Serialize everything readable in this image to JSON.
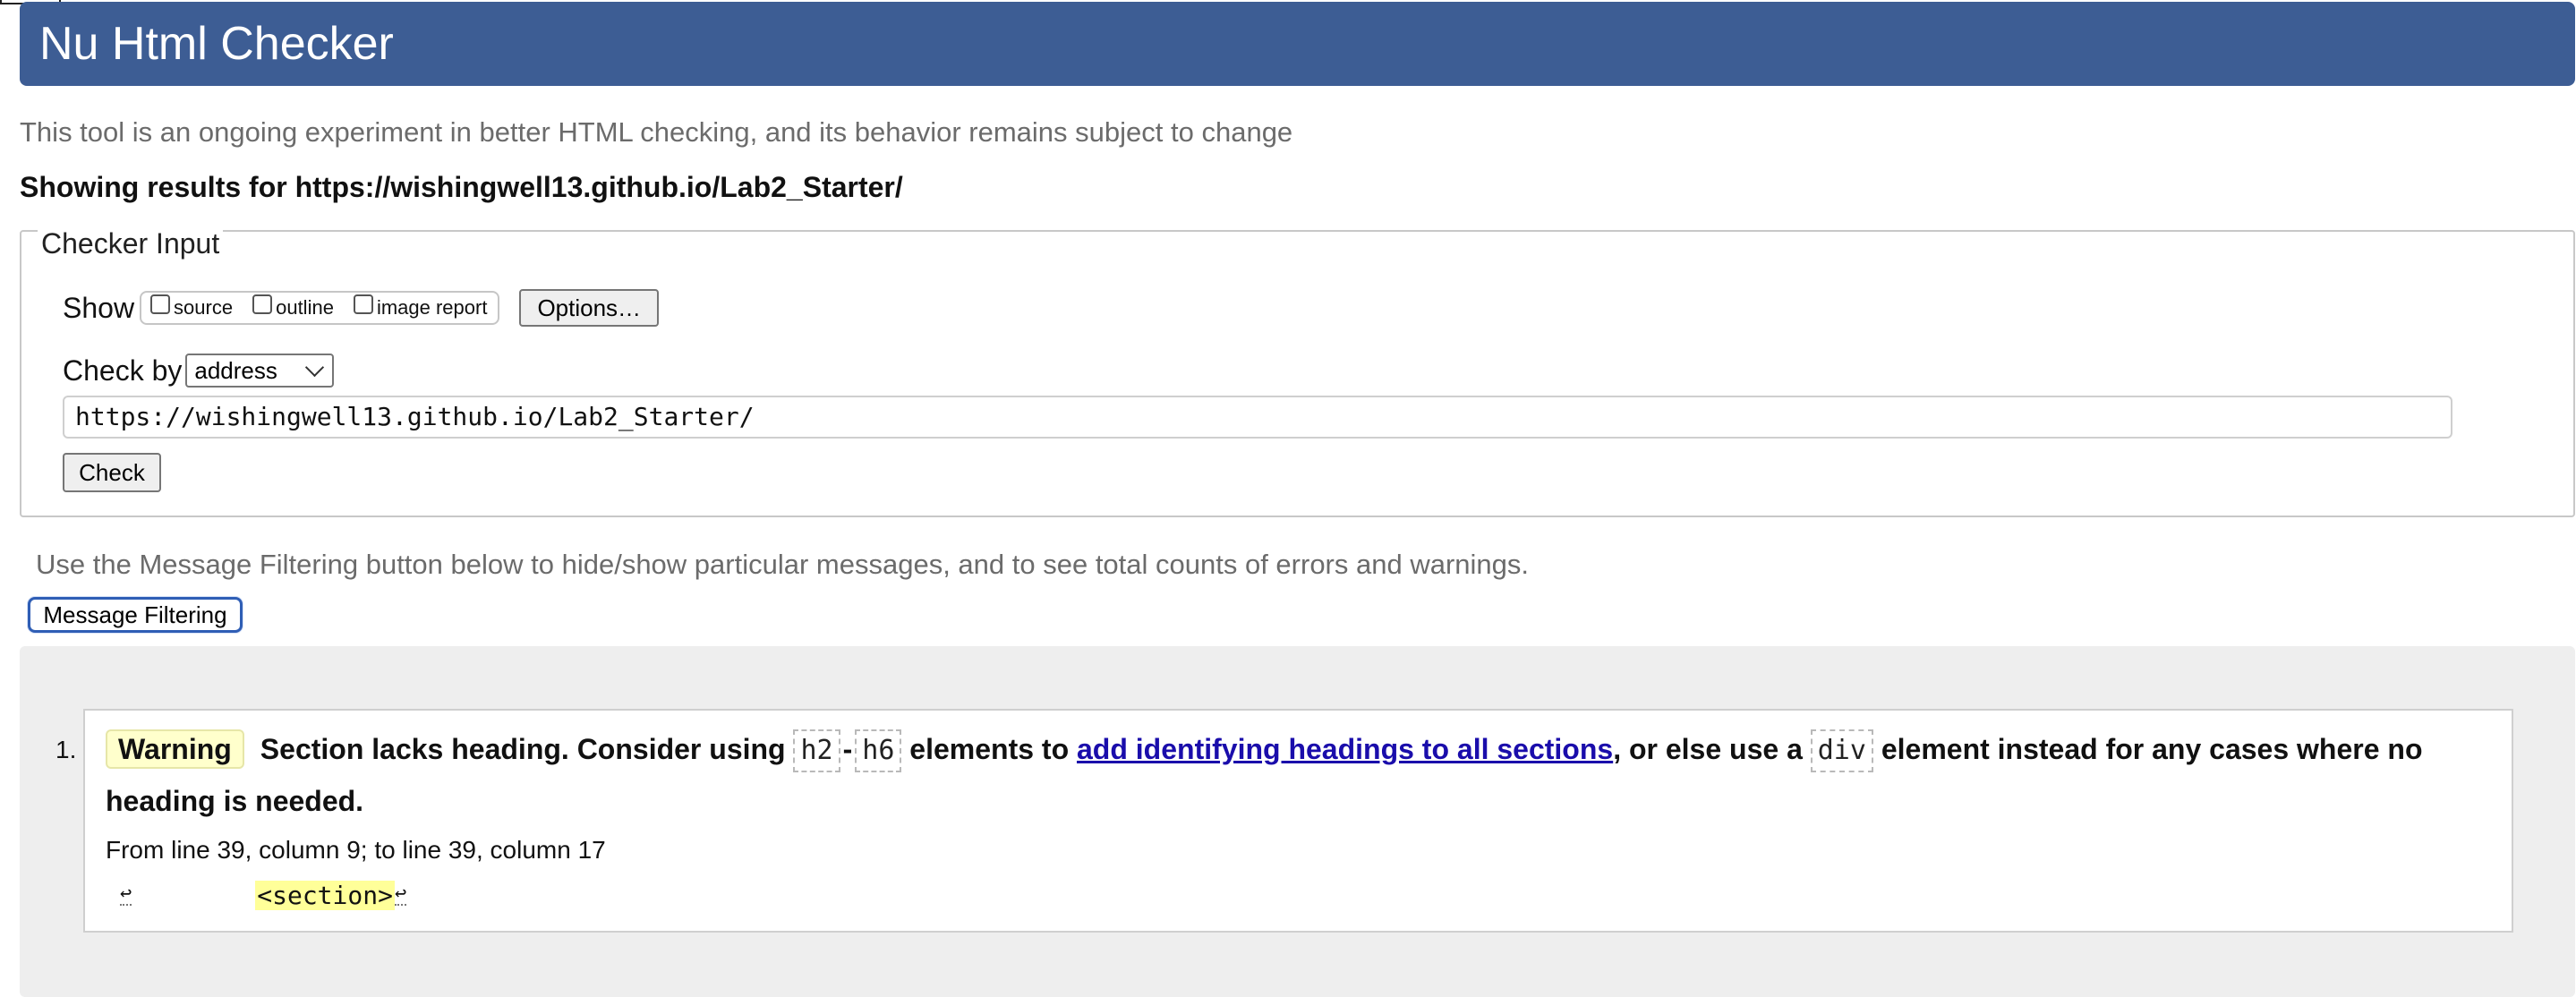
{
  "header": {
    "title": "Nu Html Checker"
  },
  "intro": "This tool is an ongoing experiment in better HTML checking, and its behavior remains subject to change",
  "showing_results": "Showing results for https://wishingwell13.github.io/Lab2_Starter/",
  "checker_input": {
    "legend": "Checker Input",
    "show_label": "Show",
    "checkboxes": [
      {
        "label": "source",
        "checked": false
      },
      {
        "label": "outline",
        "checked": false
      },
      {
        "label": "image report",
        "checked": false
      }
    ],
    "options_button": "Options…",
    "check_by_label": "Check by",
    "check_by_selected": "address",
    "url_value": "https://wishingwell13.github.io/Lab2_Starter/",
    "check_button": "Check"
  },
  "filter_hint": "Use the Message Filtering button below to hide/show particular messages, and to see total counts of errors and warnings.",
  "filter_button": "Message Filtering",
  "messages": [
    {
      "number": "1.",
      "type": "Warning",
      "text_1": "Section lacks heading. Consider using",
      "code_h2": "h2",
      "dash": "-",
      "code_h6": "h6",
      "text_2": "elements to",
      "link": "add identifying headings to all sections",
      "text_3": ", or else use a",
      "code_div": "div",
      "text_4": "element instead for any cases where no heading is needed.",
      "location": "From line 39, column 9; to line 39, column 17",
      "extract_lf": "↩",
      "extract_code": "<section>"
    }
  ],
  "colors": {
    "header_bg": "#3d5d94",
    "warning_bg": "#ffffcc",
    "link": "#1a0dab",
    "highlight": "#ffff99"
  }
}
